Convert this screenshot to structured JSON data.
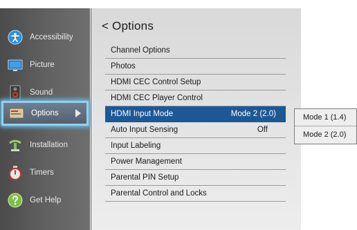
{
  "sidebar": {
    "items": [
      {
        "label": "Accessibility",
        "icon": "accessibility-icon"
      },
      {
        "label": "Picture",
        "icon": "picture-monitor-icon"
      },
      {
        "label": "Sound",
        "icon": "speaker-icon"
      },
      {
        "label": "Options",
        "icon": "options-panel-icon"
      },
      {
        "label": "Installation",
        "icon": "installation-icon"
      },
      {
        "label": "Timers",
        "icon": "timer-icon"
      },
      {
        "label": "Get Help",
        "icon": "help-icon"
      }
    ]
  },
  "panel": {
    "title": "< Options",
    "items": [
      {
        "label": "Channel Options"
      },
      {
        "label": "Photos"
      },
      {
        "label": "HDMI CEC Control Setup"
      },
      {
        "label": "HDMI CEC  Player Control"
      },
      {
        "label": "HDMI Input Mode",
        "value": "Mode 2 (2.0)"
      },
      {
        "label": "Auto Input Sensing",
        "value": "Off"
      },
      {
        "label": "Input Labeling"
      },
      {
        "label": "Power Management"
      },
      {
        "label": "Parental PIN Setup"
      },
      {
        "label": "Parental Control and Locks"
      }
    ]
  },
  "submenu": {
    "options": [
      "Mode 1 (1.4)",
      "Mode 2 (2.0)"
    ]
  },
  "colors": {
    "selection": "#1d5896",
    "focus_glow": "#8fd0f2"
  }
}
